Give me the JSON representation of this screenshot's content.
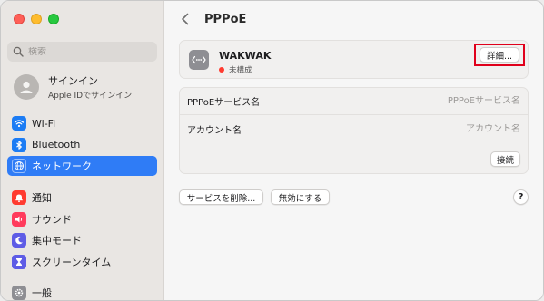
{
  "colors": {
    "accent": "#2f7cf6",
    "highlight": "#e0001b",
    "status_dot": "#ff3b30"
  },
  "sidebar": {
    "search": {
      "placeholder": "検索"
    },
    "account": {
      "name": "サインイン",
      "subtitle": "Apple IDでサインイン"
    },
    "items": [
      {
        "label": "Wi-Fi",
        "icon": "wifi-icon",
        "color": "#1c7cf4"
      },
      {
        "label": "Bluetooth",
        "icon": "bluetooth-icon",
        "color": "#1c7cf4"
      },
      {
        "label": "ネットワーク",
        "icon": "globe-icon",
        "color": "#2f7cf6",
        "selected": true
      },
      {
        "label": "通知",
        "icon": "bell-icon",
        "color": "#ff3b30"
      },
      {
        "label": "サウンド",
        "icon": "speaker-icon",
        "color": "#ff3b5c"
      },
      {
        "label": "集中モード",
        "icon": "moon-icon",
        "color": "#5e5ce6"
      },
      {
        "label": "スクリーンタイム",
        "icon": "hourglass-icon",
        "color": "#5e5ce6"
      },
      {
        "label": "一般",
        "icon": "gear-icon",
        "color": "#8e8e93"
      }
    ]
  },
  "header": {
    "title": "PPPoE"
  },
  "service": {
    "name": "WAKWAK",
    "status": "未構成",
    "details_label": "詳細..."
  },
  "form": {
    "service_name_label": "PPPoEサービス名",
    "service_name_placeholder": "PPPoEサービス名",
    "account_label": "アカウント名",
    "account_placeholder": "アカウント名",
    "connect_label": "接続"
  },
  "footer": {
    "delete_label": "サービスを削除...",
    "disable_label": "無効にする",
    "help_label": "?"
  }
}
